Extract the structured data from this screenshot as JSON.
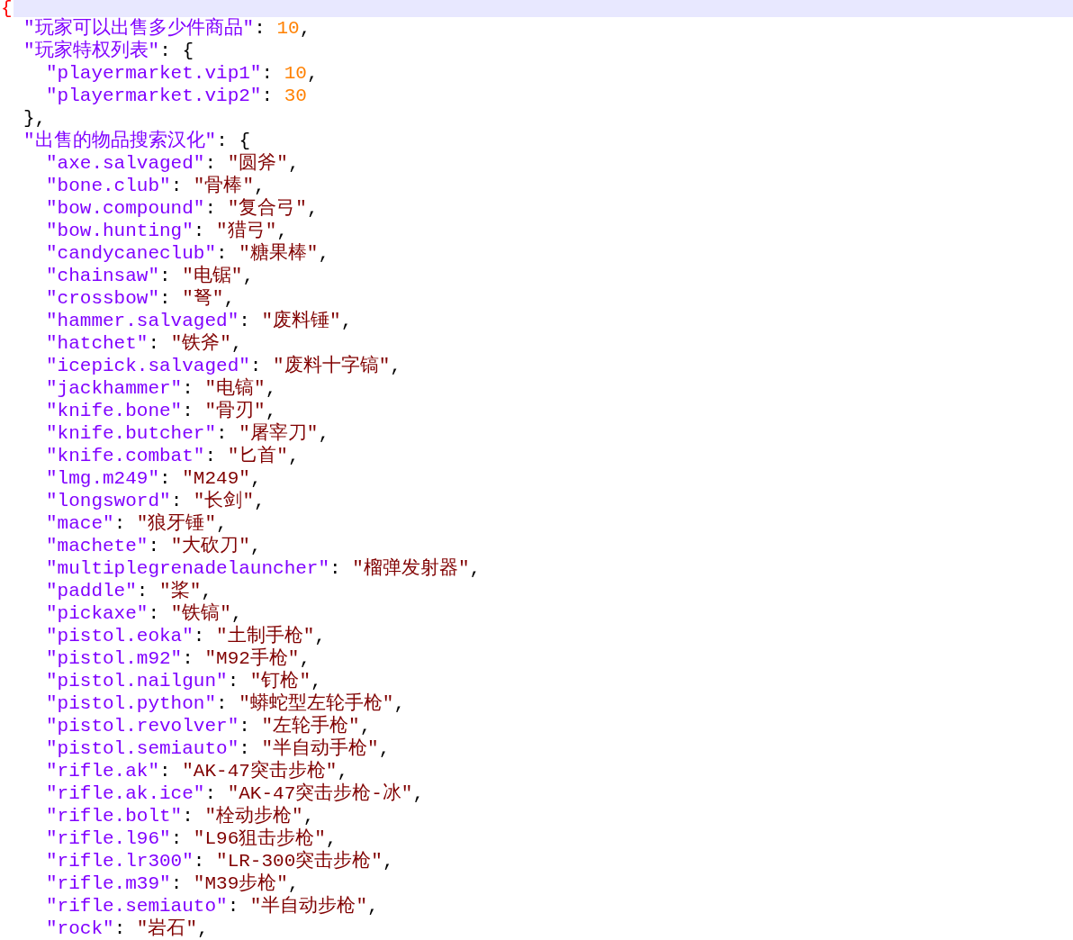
{
  "editor": {
    "open_line": {
      "text": "{",
      "highlighted": true,
      "brace_match": true
    },
    "entries": [
      {
        "kind": "number",
        "key": "\"玩家可以出售多少件商品\"",
        "colon": ":",
        "value": "10",
        "comma": ","
      },
      {
        "kind": "object",
        "key": "\"玩家特权列表\"",
        "colon": ":",
        "open": "{",
        "close": "}",
        "comma": ",",
        "children": [
          {
            "kind": "number",
            "key": "\"playermarket.vip1\"",
            "colon": ":",
            "value": "10",
            "comma": ","
          },
          {
            "kind": "number",
            "key": "\"playermarket.vip2\"",
            "colon": ":",
            "value": "30"
          }
        ]
      },
      {
        "kind": "object",
        "key": "\"出售的物品搜索汉化\"",
        "colon": ":",
        "open": "{",
        "children": [
          {
            "kind": "string",
            "key": "\"axe.salvaged\"",
            "colon": ":",
            "value": "\"圆斧\"",
            "comma": ","
          },
          {
            "kind": "string",
            "key": "\"bone.club\"",
            "colon": ":",
            "value": "\"骨棒\"",
            "comma": ","
          },
          {
            "kind": "string",
            "key": "\"bow.compound\"",
            "colon": ":",
            "value": "\"复合弓\"",
            "comma": ","
          },
          {
            "kind": "string",
            "key": "\"bow.hunting\"",
            "colon": ":",
            "value": "\"猎弓\"",
            "comma": ","
          },
          {
            "kind": "string",
            "key": "\"candycaneclub\"",
            "colon": ":",
            "value": "\"糖果棒\"",
            "comma": ","
          },
          {
            "kind": "string",
            "key": "\"chainsaw\"",
            "colon": ":",
            "value": "\"电锯\"",
            "comma": ","
          },
          {
            "kind": "string",
            "key": "\"crossbow\"",
            "colon": ":",
            "value": "\"弩\"",
            "comma": ","
          },
          {
            "kind": "string",
            "key": "\"hammer.salvaged\"",
            "colon": ":",
            "value": "\"废料锤\"",
            "comma": ","
          },
          {
            "kind": "string",
            "key": "\"hatchet\"",
            "colon": ":",
            "value": "\"铁斧\"",
            "comma": ","
          },
          {
            "kind": "string",
            "key": "\"icepick.salvaged\"",
            "colon": ":",
            "value": "\"废料十字镐\"",
            "comma": ","
          },
          {
            "kind": "string",
            "key": "\"jackhammer\"",
            "colon": ":",
            "value": "\"电镐\"",
            "comma": ","
          },
          {
            "kind": "string",
            "key": "\"knife.bone\"",
            "colon": ":",
            "value": "\"骨刃\"",
            "comma": ","
          },
          {
            "kind": "string",
            "key": "\"knife.butcher\"",
            "colon": ":",
            "value": "\"屠宰刀\"",
            "comma": ","
          },
          {
            "kind": "string",
            "key": "\"knife.combat\"",
            "colon": ":",
            "value": "\"匕首\"",
            "comma": ","
          },
          {
            "kind": "string",
            "key": "\"lmg.m249\"",
            "colon": ":",
            "value": "\"M249\"",
            "comma": ","
          },
          {
            "kind": "string",
            "key": "\"longsword\"",
            "colon": ":",
            "value": "\"长剑\"",
            "comma": ","
          },
          {
            "kind": "string",
            "key": "\"mace\"",
            "colon": ":",
            "value": "\"狼牙锤\"",
            "comma": ","
          },
          {
            "kind": "string",
            "key": "\"machete\"",
            "colon": ":",
            "value": "\"大砍刀\"",
            "comma": ","
          },
          {
            "kind": "string",
            "key": "\"multiplegrenadelauncher\"",
            "colon": ":",
            "value": "\"榴弹发射器\"",
            "comma": ","
          },
          {
            "kind": "string",
            "key": "\"paddle\"",
            "colon": ":",
            "value": "\"桨\"",
            "comma": ","
          },
          {
            "kind": "string",
            "key": "\"pickaxe\"",
            "colon": ":",
            "value": "\"铁镐\"",
            "comma": ","
          },
          {
            "kind": "string",
            "key": "\"pistol.eoka\"",
            "colon": ":",
            "value": "\"土制手枪\"",
            "comma": ","
          },
          {
            "kind": "string",
            "key": "\"pistol.m92\"",
            "colon": ":",
            "value": "\"M92手枪\"",
            "comma": ","
          },
          {
            "kind": "string",
            "key": "\"pistol.nailgun\"",
            "colon": ":",
            "value": "\"钉枪\"",
            "comma": ","
          },
          {
            "kind": "string",
            "key": "\"pistol.python\"",
            "colon": ":",
            "value": "\"蟒蛇型左轮手枪\"",
            "comma": ","
          },
          {
            "kind": "string",
            "key": "\"pistol.revolver\"",
            "colon": ":",
            "value": "\"左轮手枪\"",
            "comma": ","
          },
          {
            "kind": "string",
            "key": "\"pistol.semiauto\"",
            "colon": ":",
            "value": "\"半自动手枪\"",
            "comma": ","
          },
          {
            "kind": "string",
            "key": "\"rifle.ak\"",
            "colon": ":",
            "value": "\"AK-47突击步枪\"",
            "comma": ","
          },
          {
            "kind": "string",
            "key": "\"rifle.ak.ice\"",
            "colon": ":",
            "value": "\"AK-47突击步枪-冰\"",
            "comma": ","
          },
          {
            "kind": "string",
            "key": "\"rifle.bolt\"",
            "colon": ":",
            "value": "\"栓动步枪\"",
            "comma": ","
          },
          {
            "kind": "string",
            "key": "\"rifle.l96\"",
            "colon": ":",
            "value": "\"L96狙击步枪\"",
            "comma": ","
          },
          {
            "kind": "string",
            "key": "\"rifle.lr300\"",
            "colon": ":",
            "value": "\"LR-300突击步枪\"",
            "comma": ","
          },
          {
            "kind": "string",
            "key": "\"rifle.m39\"",
            "colon": ":",
            "value": "\"M39步枪\"",
            "comma": ","
          },
          {
            "kind": "string",
            "key": "\"rifle.semiauto\"",
            "colon": ":",
            "value": "\"半自动步枪\"",
            "comma": ","
          },
          {
            "kind": "string",
            "key": "\"rock\"",
            "colon": ":",
            "value": "\"岩石\"",
            "comma": ","
          }
        ]
      }
    ]
  }
}
